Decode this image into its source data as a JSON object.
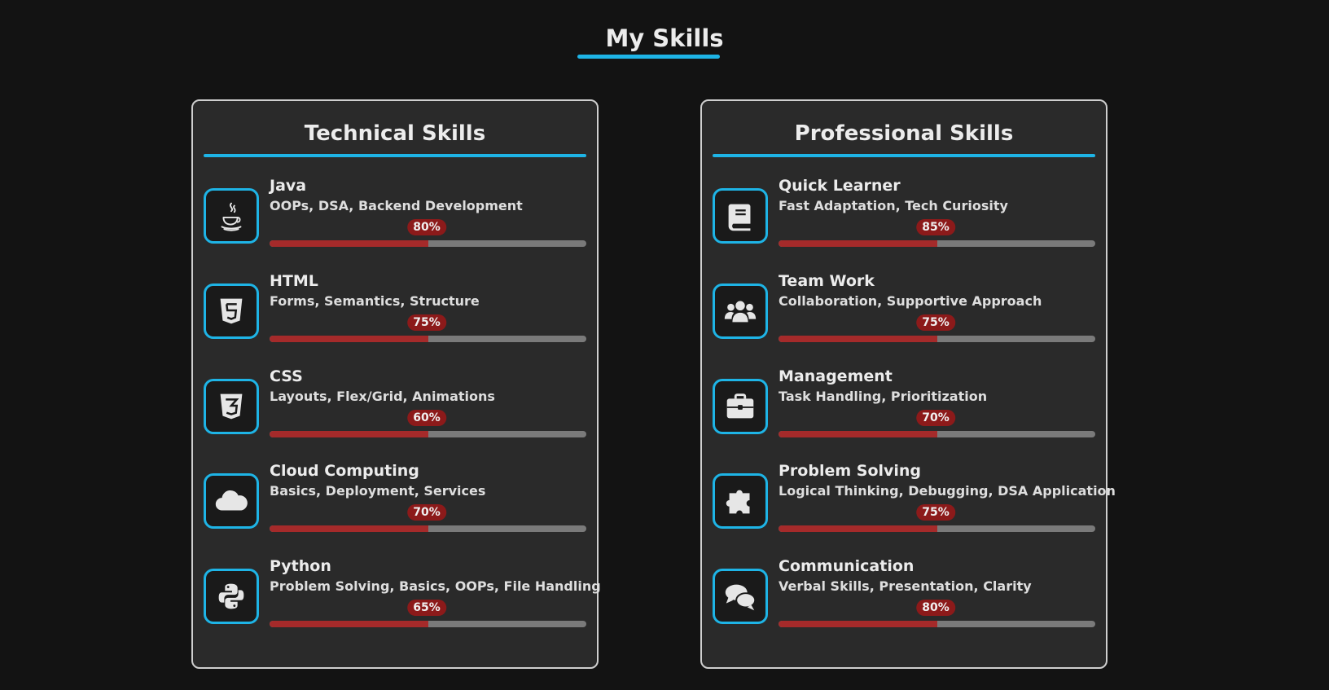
{
  "page": {
    "title": "My Skills"
  },
  "accent_color": "#1eb4e6",
  "bar_fill_color": "#a52a2a",
  "technical": {
    "title": "Technical Skills",
    "skills": [
      {
        "name": "Java",
        "desc": "OOPs, DSA, Backend Development",
        "percent_label": "80%",
        "fill_fraction": 0.5,
        "icon": "java-icon"
      },
      {
        "name": "HTML",
        "desc": "Forms, Semantics, Structure",
        "percent_label": "75%",
        "fill_fraction": 0.5,
        "icon": "html5-icon"
      },
      {
        "name": "CSS",
        "desc": "Layouts, Flex/Grid, Animations",
        "percent_label": "60%",
        "fill_fraction": 0.5,
        "icon": "css3-icon"
      },
      {
        "name": "Cloud Computing",
        "desc": "Basics, Deployment, Services",
        "percent_label": "70%",
        "fill_fraction": 0.5,
        "icon": "cloud-icon"
      },
      {
        "name": "Python",
        "desc": "Problem Solving, Basics, OOPs, File Handling",
        "percent_label": "65%",
        "fill_fraction": 0.5,
        "icon": "python-icon"
      }
    ]
  },
  "professional": {
    "title": "Professional Skills",
    "skills": [
      {
        "name": "Quick Learner",
        "desc": "Fast Adaptation, Tech Curiosity",
        "percent_label": "85%",
        "fill_fraction": 0.5,
        "icon": "book-icon"
      },
      {
        "name": "Team Work",
        "desc": "Collaboration, Supportive Approach",
        "percent_label": "75%",
        "fill_fraction": 0.5,
        "icon": "users-icon"
      },
      {
        "name": "Management",
        "desc": "Task Handling, Prioritization",
        "percent_label": "70%",
        "fill_fraction": 0.5,
        "icon": "briefcase-icon"
      },
      {
        "name": "Problem Solving",
        "desc": "Logical Thinking, Debugging, DSA Application",
        "percent_label": "75%",
        "fill_fraction": 0.5,
        "icon": "puzzle-icon"
      },
      {
        "name": "Communication",
        "desc": "Verbal Skills, Presentation, Clarity",
        "percent_label": "80%",
        "fill_fraction": 0.5,
        "icon": "comments-icon"
      }
    ]
  }
}
